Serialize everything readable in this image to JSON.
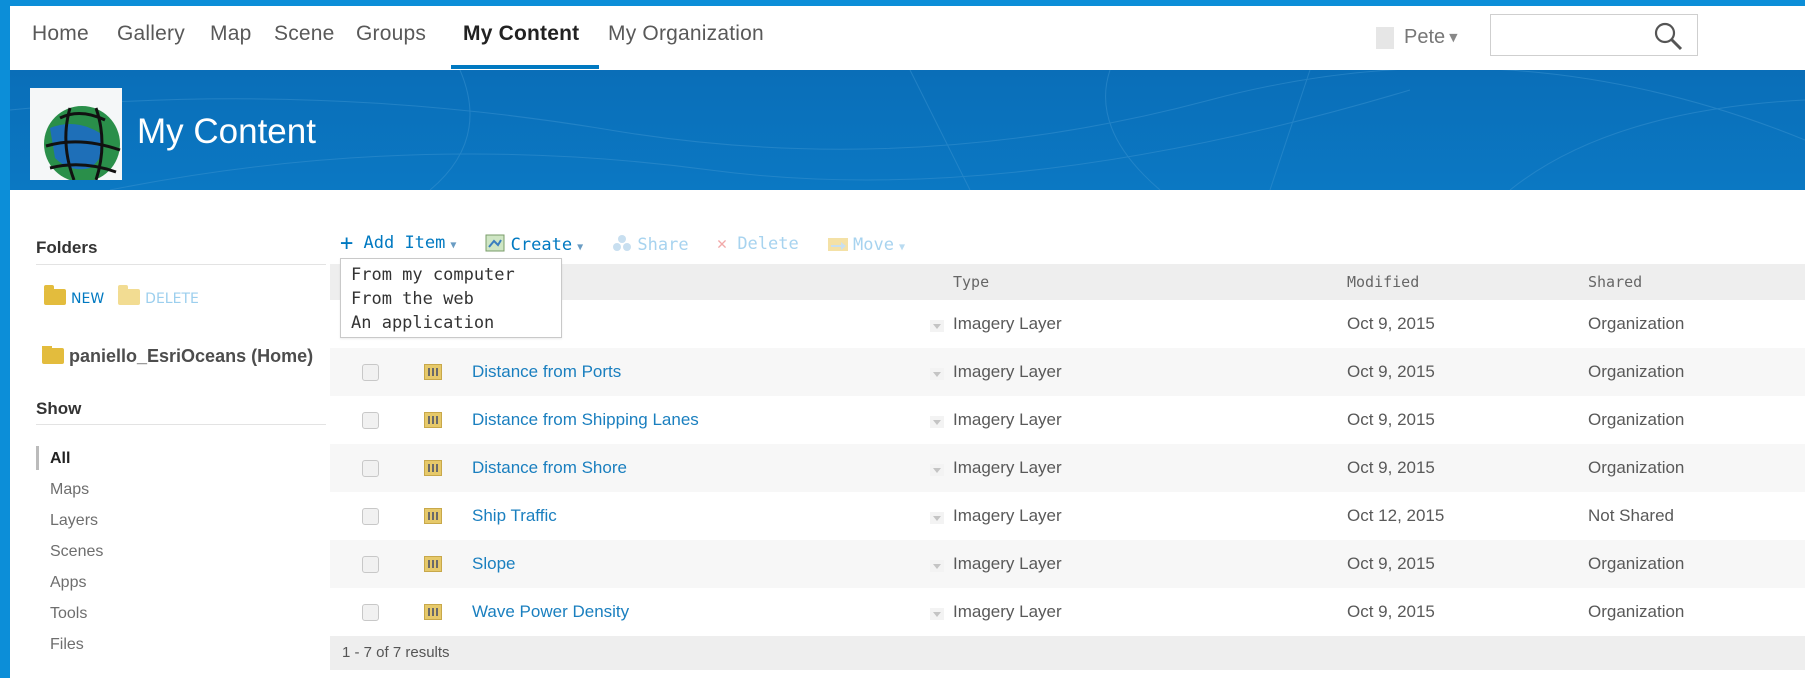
{
  "nav": {
    "items": [
      "Home",
      "Gallery",
      "Map",
      "Scene",
      "Groups",
      "My Content",
      "My Organization"
    ],
    "active_index": 5,
    "user_name": "Pete",
    "search_placeholder": ""
  },
  "banner": {
    "title": "My Content"
  },
  "sidebar": {
    "folders_heading": "Folders",
    "new_label": "NEW",
    "delete_label": "DELETE",
    "home_folder": "paniello_EsriOceans (Home)",
    "show_heading": "Show",
    "show_items": [
      "All",
      "Maps",
      "Layers",
      "Scenes",
      "Apps",
      "Tools",
      "Files"
    ],
    "show_active_index": 0
  },
  "toolbar": {
    "add_item": "Add Item",
    "create": "Create",
    "share": "Share",
    "delete": "Delete",
    "move": "Move"
  },
  "add_item_menu": [
    "From my computer",
    "From the web",
    "An application"
  ],
  "table": {
    "columns": {
      "type": "Type",
      "modified": "Modified",
      "shared": "Shared"
    },
    "rows": [
      {
        "title": "",
        "type": "Imagery Layer",
        "modified": "Oct 9, 2015",
        "shared": "Organization"
      },
      {
        "title": "Distance from Ports",
        "type": "Imagery Layer",
        "modified": "Oct 9, 2015",
        "shared": "Organization"
      },
      {
        "title": "Distance from Shipping Lanes",
        "type": "Imagery Layer",
        "modified": "Oct 9, 2015",
        "shared": "Organization"
      },
      {
        "title": "Distance from Shore",
        "type": "Imagery Layer",
        "modified": "Oct 9, 2015",
        "shared": "Organization"
      },
      {
        "title": "Ship Traffic",
        "type": "Imagery Layer",
        "modified": "Oct 12, 2015",
        "shared": "Not Shared"
      },
      {
        "title": "Slope",
        "type": "Imagery Layer",
        "modified": "Oct 9, 2015",
        "shared": "Organization"
      },
      {
        "title": "Wave Power Density",
        "type": "Imagery Layer",
        "modified": "Oct 9, 2015",
        "shared": "Organization"
      }
    ],
    "results_label": "1 - 7 of 7 results"
  },
  "colors": {
    "brand_blue": "#0079c1",
    "banner_blue": "#0b78c3",
    "page_frame_blue": "#0c8ed8",
    "link_blue": "#1a7fbf"
  }
}
